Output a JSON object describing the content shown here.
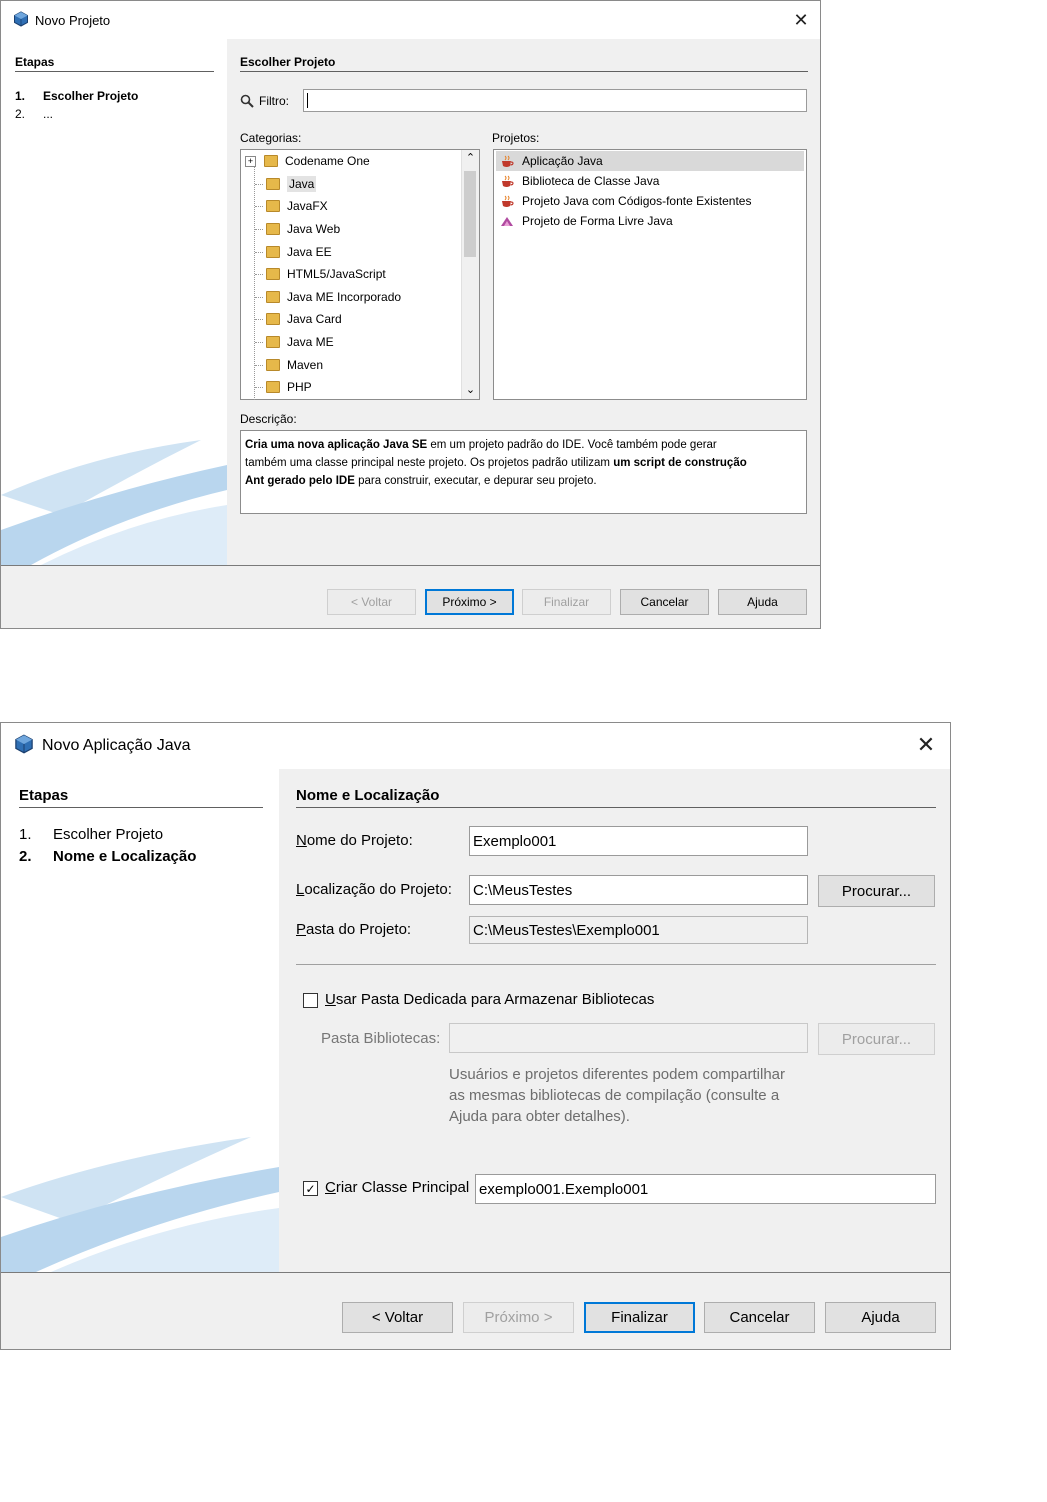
{
  "dialog1": {
    "title": "Novo Projeto",
    "steps_heading": "Etapas",
    "steps": [
      {
        "num": "1.",
        "label": "Escolher Projeto"
      },
      {
        "num": "2.",
        "label": "..."
      }
    ],
    "section_heading": "Escolher Projeto",
    "filter_label": "Filtro:",
    "filter_value": "",
    "categories_label": "Categorias:",
    "categories": [
      "Codename One",
      "Java",
      "JavaFX",
      "Java Web",
      "Java EE",
      "HTML5/JavaScript",
      "Java ME Incorporado",
      "Java Card",
      "Java ME",
      "Maven",
      "PHP"
    ],
    "selected_category": "Java",
    "projects_label": "Projetos:",
    "projects": [
      "Aplicação Java",
      "Biblioteca de Classe Java",
      "Projeto Java com Códigos-fonte Existentes",
      "Projeto de Forma Livre Java"
    ],
    "selected_project": "Aplicação Java",
    "description_label": "Descrição:",
    "description": {
      "b1": "Cria uma nova aplicação Java SE",
      "t1": " em um projeto padrão do IDE. Você também pode gerar",
      "t2": "também uma classe principal neste projeto. Os projetos padrão utilizam ",
      "b2": "um script de construção",
      "b3": "Ant gerado pelo IDE",
      "t3": " para construir, executar, e depurar seu projeto."
    },
    "buttons": {
      "back": "< Voltar",
      "next": "Próximo >",
      "finish": "Finalizar",
      "cancel": "Cancelar",
      "help": "Ajuda"
    }
  },
  "dialog2": {
    "title": "Novo Aplicação Java",
    "steps_heading": "Etapas",
    "steps": [
      {
        "num": "1.",
        "label": "Escolher Projeto"
      },
      {
        "num": "2.",
        "label": "Nome e Localização"
      }
    ],
    "section_heading": "Nome e Localização",
    "project_name_label": "Nome do Projeto:",
    "project_name_value": "Exemplo001",
    "project_location_label": "Localização do Projeto:",
    "project_location_value": "C:\\MeusTestes",
    "browse_label": "Procurar...",
    "project_folder_label": "Pasta do Projeto:",
    "project_folder_value": "C:\\MeusTestes\\Exemplo001",
    "dedicated_folder_label": "Usar Pasta Dedicada para Armazenar Bibliotecas",
    "dedicated_folder_checked": false,
    "libraries_folder_label": "Pasta Bibliotecas:",
    "libraries_folder_value": "",
    "libraries_browse_label": "Procurar...",
    "help_text": [
      "Usuários e projetos diferentes podem compartilhar",
      "as mesmas bibliotecas de compilação (consulte a",
      "Ajuda para obter detalhes)."
    ],
    "main_class_label": "Criar Classe Principal",
    "main_class_checked": true,
    "main_class_value": "exemplo001.Exemplo001",
    "buttons": {
      "back": "< Voltar",
      "next": "Próximo >",
      "finish": "Finalizar",
      "cancel": "Cancelar",
      "help": "Ajuda"
    }
  }
}
